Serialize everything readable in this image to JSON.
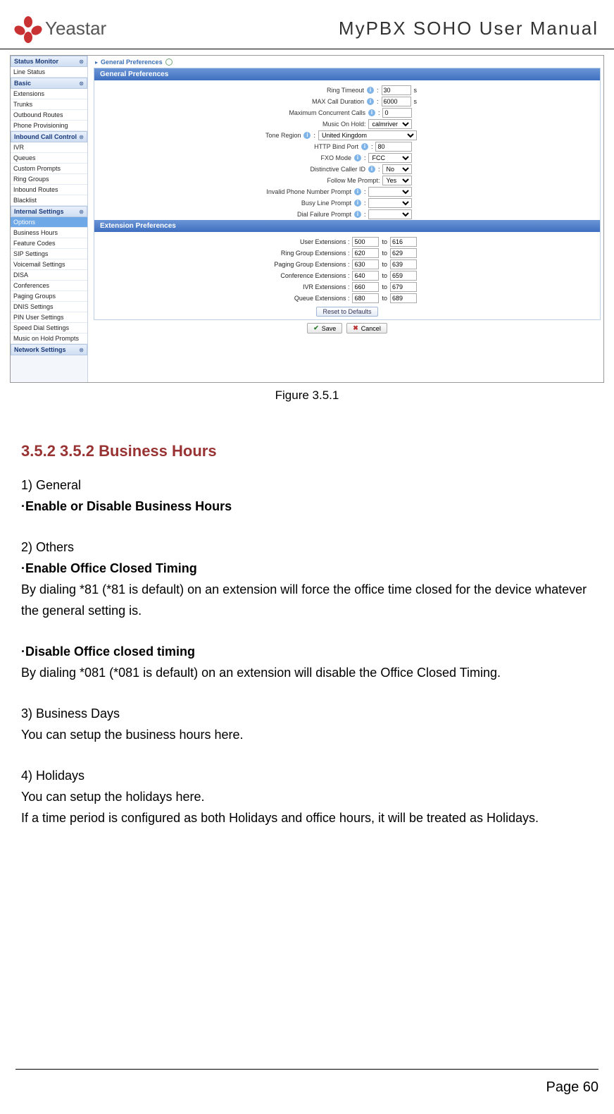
{
  "header": {
    "brand": "Yeastar",
    "title": "MyPBX SOHO User Manual"
  },
  "breadcrumb": {
    "text": "General Preferences"
  },
  "sidebar": {
    "groups": [
      {
        "title": "Status Monitor",
        "items": [
          "Line Status"
        ]
      },
      {
        "title": "Basic",
        "items": [
          "Extensions",
          "Trunks",
          "Outbound Routes",
          "Phone Provisioning"
        ]
      },
      {
        "title": "Inbound Call Control",
        "items": [
          "IVR",
          "Queues",
          "Custom Prompts",
          "Ring Groups",
          "Inbound Routes",
          "Blacklist"
        ]
      },
      {
        "title": "Internal Settings",
        "items": [
          "Options",
          "Business Hours",
          "Feature Codes",
          "SIP Settings",
          "Voicemail Settings",
          "DISA",
          "Conferences",
          "Paging Groups",
          "DNIS Settings",
          "PIN User Settings",
          "Speed Dial Settings",
          "Music on Hold Prompts"
        ],
        "selectedIndex": 0
      },
      {
        "title": "Network Settings",
        "items": []
      }
    ]
  },
  "panels": {
    "general": {
      "title": "General Preferences",
      "ring_timeout_label": "Ring Timeout",
      "ring_timeout": "30",
      "ring_timeout_unit": "s",
      "max_call_label": "MAX Call Duration",
      "max_call": "6000",
      "max_call_unit": "s",
      "max_conc_label": "Maximum Concurrent Calls",
      "max_conc": "0",
      "moh_label": "Music On Hold:",
      "moh": "calmriver",
      "tone_label": "Tone Region",
      "tone": "United Kingdom",
      "http_label": "HTTP Bind Port",
      "http": "80",
      "fxo_label": "FXO Mode",
      "fxo": "FCC",
      "cid_label": "Distinctive Caller ID",
      "cid": "No",
      "follow_label": "Follow Me Prompt:",
      "follow": "Yes",
      "invalid_label": "Invalid Phone Number Prompt",
      "busy_label": "Busy Line Prompt",
      "dialfail_label": "Dial Failure Prompt"
    },
    "ext": {
      "title": "Extension Preferences",
      "rows": [
        {
          "label": "User Extensions :",
          "from": "500",
          "to": "616"
        },
        {
          "label": "Ring Group Extensions :",
          "from": "620",
          "to": "629"
        },
        {
          "label": "Paging Group Extensions :",
          "from": "630",
          "to": "639"
        },
        {
          "label": "Conference Extensions :",
          "from": "640",
          "to": "659"
        },
        {
          "label": "IVR Extensions :",
          "from": "660",
          "to": "679"
        },
        {
          "label": "Queue Extensions :",
          "from": "680",
          "to": "689"
        }
      ],
      "to_label": "to",
      "reset": "Reset to Defaults"
    }
  },
  "buttons": {
    "save": "Save",
    "cancel": "Cancel"
  },
  "figure_caption": "Figure 3.5.1",
  "doc": {
    "section_heading": "3.5.2 3.5.2 Business Hours",
    "l1": "1)  General",
    "l2": "·Enable or Disable Business Hours",
    "l3": "2)  Others",
    "l4": "·Enable Office Closed Timing",
    "l5": "By dialing *81 (*81 is default) on an extension will force the office time closed for the device whatever the general setting is.",
    "l6": "·Disable Office closed timing",
    "l7": "By dialing *081 (*081 is default) on an extension will disable the Office Closed Timing.",
    "l8": "3)  Business Days",
    "l9": "You can setup the business hours here.",
    "l10": "4)  Holidays",
    "l11": "You can setup the holidays here.",
    "l12": "If a time period is configured as both Holidays and office hours, it will be treated as Holidays."
  },
  "footer": {
    "text": "Page 60"
  }
}
